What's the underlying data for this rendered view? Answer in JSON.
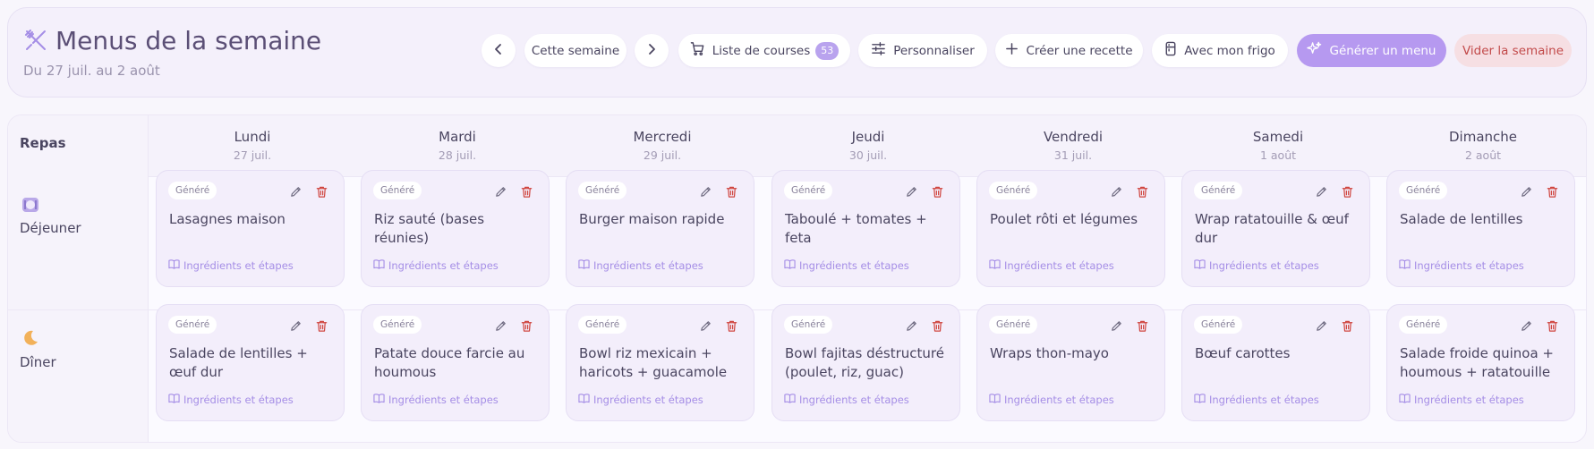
{
  "header": {
    "title": "Menus de la semaine",
    "subtitle": "Du 27 juil. au 2 août",
    "week_label": "Cette semaine",
    "shopping_label": "Liste de courses",
    "shopping_count": "53",
    "customize_label": "Personnaliser",
    "create_recipe_label": "Créer une recette",
    "fridge_label": "Avec mon frigo",
    "generate_label": "Générer un menu",
    "clear_label": "Vider la semaine"
  },
  "colors": {
    "accent": "#b699f0",
    "danger": "#c24a4a",
    "background": "#f8f6fc"
  },
  "grid": {
    "meal_column_header": "Repas",
    "days": [
      {
        "name": "Lundi",
        "date": "27 juil."
      },
      {
        "name": "Mardi",
        "date": "28 juil."
      },
      {
        "name": "Mercredi",
        "date": "29 juil."
      },
      {
        "name": "Jeudi",
        "date": "30 juil."
      },
      {
        "name": "Vendredi",
        "date": "31 juil."
      },
      {
        "name": "Samedi",
        "date": "1 août"
      },
      {
        "name": "Dimanche",
        "date": "2 août"
      }
    ],
    "meals": [
      {
        "label": "Déjeuner",
        "icon": "plate-icon",
        "items": [
          {
            "tag": "Généré",
            "name": "Lasagnes maison",
            "link": "Ingrédients et étapes"
          },
          {
            "tag": "Généré",
            "name": "Riz sauté (bases réunies)",
            "link": "Ingrédients et étapes"
          },
          {
            "tag": "Généré",
            "name": "Burger maison rapide",
            "link": "Ingrédients et étapes"
          },
          {
            "tag": "Généré",
            "name": "Taboulé + tomates + feta",
            "link": "Ingrédients et étapes"
          },
          {
            "tag": "Généré",
            "name": "Poulet rôti et légumes",
            "link": "Ingrédients et étapes"
          },
          {
            "tag": "Généré",
            "name": "Wrap ratatouille & œuf dur",
            "link": "Ingrédients et étapes"
          },
          {
            "tag": "Généré",
            "name": "Salade de lentilles",
            "link": "Ingrédients et étapes"
          }
        ]
      },
      {
        "label": "Dîner",
        "icon": "moon-icon",
        "items": [
          {
            "tag": "Généré",
            "name": "Salade de lentilles + œuf dur",
            "link": "Ingrédients et étapes"
          },
          {
            "tag": "Généré",
            "name": "Patate douce farcie au houmous",
            "link": "Ingrédients et étapes"
          },
          {
            "tag": "Généré",
            "name": "Bowl riz mexicain + haricots + guacamole",
            "link": "Ingrédients et étapes"
          },
          {
            "tag": "Généré",
            "name": "Bowl fajitas déstructuré (poulet, riz, guac)",
            "link": "Ingrédients et étapes"
          },
          {
            "tag": "Généré",
            "name": "Wraps thon-mayo",
            "link": "Ingrédients et étapes"
          },
          {
            "tag": "Généré",
            "name": "Bœuf carottes",
            "link": "Ingrédients et étapes"
          },
          {
            "tag": "Généré",
            "name": "Salade froide quinoa + houmous + ratatouille",
            "link": "Ingrédients et étapes"
          }
        ]
      }
    ]
  }
}
